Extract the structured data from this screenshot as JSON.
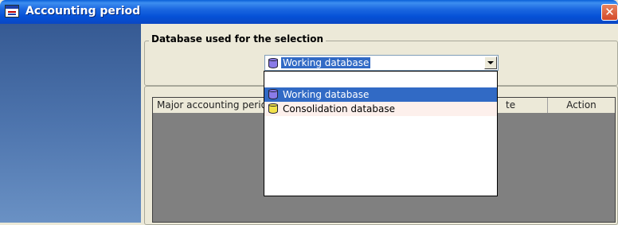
{
  "window": {
    "title": "Accounting period",
    "close_glyph": "✕"
  },
  "selection_group": {
    "label": "Database used for the selection",
    "combo": {
      "selected_value": "Working database",
      "icon": "database-blue-icon"
    }
  },
  "grid": {
    "columns": [
      "Major accounting period",
      "te",
      "Action"
    ]
  },
  "dropdown": {
    "options": [
      {
        "label": "Working database",
        "icon": "database-blue-icon",
        "state": "selected"
      },
      {
        "label": "Consolidation database",
        "icon": "database-yellow-icon",
        "state": "hover"
      }
    ]
  },
  "colors": {
    "titlebar": "#0551d6",
    "selection": "#316ac5",
    "grid_background": "#808080",
    "left_panel": "#4d74ad"
  }
}
